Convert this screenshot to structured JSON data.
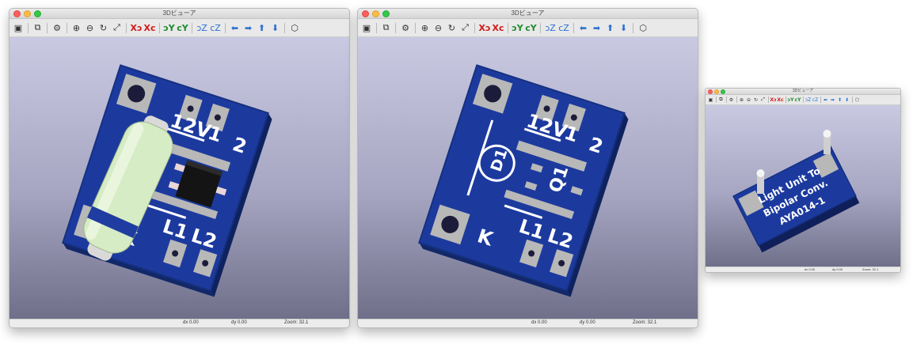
{
  "windows": [
    {
      "title": "3Dビューア",
      "status": {
        "dx": "dx 0.00",
        "dy": "dy 0.00",
        "zoom": "Zoom: 32.1"
      }
    },
    {
      "title": "3Dビューア",
      "status": {
        "dx": "dx 0.00",
        "dy": "dy 0.00",
        "zoom": "Zoom: 32.1"
      }
    },
    {
      "title": "3Dビューア",
      "status": {
        "dx": "dx 0.00",
        "dy": "dy 0.00",
        "zoom": "Zoom: 32.1"
      }
    }
  ],
  "toolbar_icons": [
    {
      "name": "reload-board-icon",
      "glyph": "▣"
    },
    {
      "name": "copy-image-icon",
      "glyph": "⧉"
    },
    {
      "name": "settings-icon",
      "glyph": "⚙"
    },
    {
      "name": "zoom-in-icon",
      "glyph": "⊕"
    },
    {
      "name": "zoom-out-icon",
      "glyph": "⊖"
    },
    {
      "name": "redraw-icon",
      "glyph": "↻"
    },
    {
      "name": "zoom-fit-icon",
      "glyph": "⤢"
    },
    {
      "name": "rotate-x-cw-icon",
      "glyph": "Xↄ"
    },
    {
      "name": "rotate-x-ccw-icon",
      "glyph": "Xc"
    },
    {
      "name": "rotate-y-cw-icon",
      "glyph": "ↄY"
    },
    {
      "name": "rotate-y-ccw-icon",
      "glyph": "cY"
    },
    {
      "name": "rotate-z-cw-icon",
      "glyph": "ↄZ"
    },
    {
      "name": "rotate-z-ccw-icon",
      "glyph": "cZ"
    },
    {
      "name": "move-left-icon",
      "glyph": "⬅"
    },
    {
      "name": "move-right-icon",
      "glyph": "➡"
    },
    {
      "name": "move-up-icon",
      "glyph": "⬆"
    },
    {
      "name": "move-down-icon",
      "glyph": "⬇"
    },
    {
      "name": "ortho-view-icon",
      "glyph": "⬡"
    }
  ],
  "board": {
    "label_12v": "12V",
    "label_1": "1",
    "label_2": "2",
    "label_l1": "L1",
    "label_l2": "L2",
    "label_k": "K",
    "label_d1": "D1",
    "label_q1": "Q1",
    "back_line1": "Light Unit To",
    "back_line2": "Bipolar Conv.",
    "back_line3": "AYA014-1"
  },
  "colors": {
    "pcb_top": "#1c3a9e",
    "pcb_edge": "#132a74",
    "pad": "#b8b8b8",
    "silk": "#ffffff",
    "resistor_body": "#d6ecc4",
    "resistor_band": "#1f3da0",
    "viewport_top": "#c9c9e2",
    "viewport_bottom": "#6f6f8a"
  }
}
